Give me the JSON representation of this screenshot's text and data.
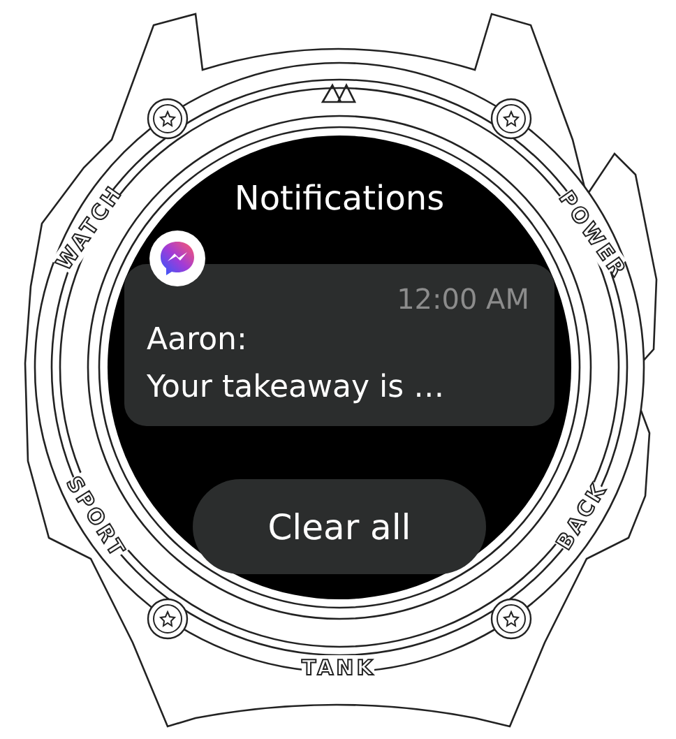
{
  "bezel": {
    "labels": [
      "WATCH",
      "POWER",
      "SPORT",
      "BACK",
      "TANK"
    ]
  },
  "screen": {
    "title": "Notifications",
    "notifications": [
      {
        "time": "12:00 AM",
        "sender": "Aaron:",
        "message": "Your takeaway is …"
      }
    ],
    "button": "Clear all"
  }
}
